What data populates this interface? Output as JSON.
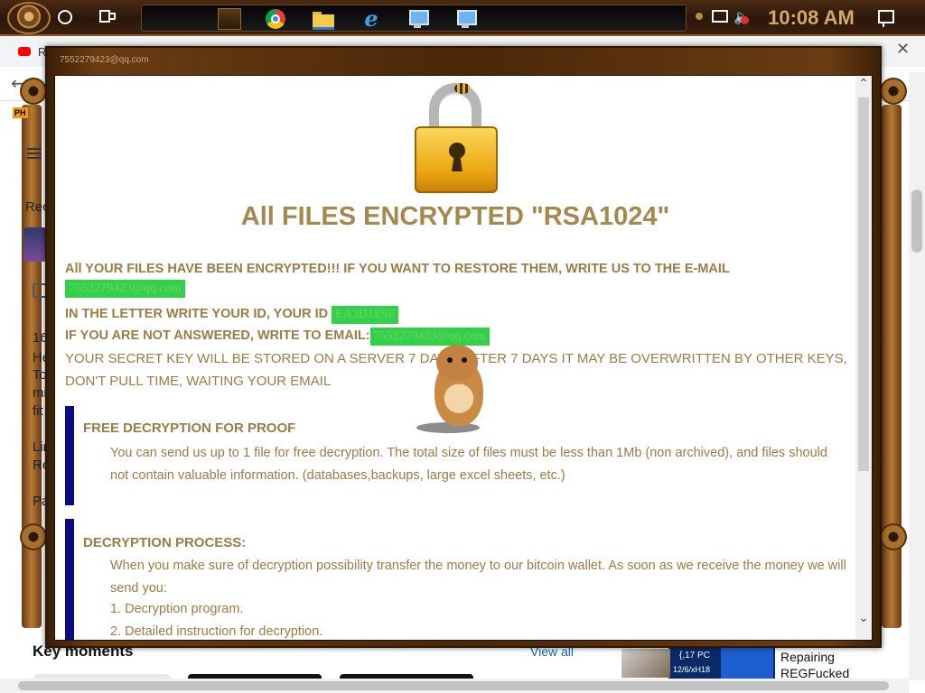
{
  "taskbar": {
    "clock": "10:08 AM",
    "apps": [
      "file-manager",
      "chrome",
      "file-explorer",
      "internet-explorer",
      "computer",
      "computer"
    ]
  },
  "browser": {
    "tab_title": "R",
    "close_x": "✕",
    "back_arrow": "←",
    "ph_badge": "PH",
    "texts": {
      "rec": "Rec",
      "line_16": "16",
      "line_he": "He",
      "line_to": "To",
      "line_mi": "mi",
      "line_fit": "fit",
      "line_lir": "Lir",
      "line_re": "Re",
      "line_pa": "Pa"
    },
    "key_moments": "Key moments",
    "view_all": "View all",
    "side_card": {
      "caption1": "{,17 PC",
      "caption2": "12/6/xH18",
      "title1": "Repairing",
      "title2": "REGFucked"
    }
  },
  "ransom": {
    "window_title": "7552279423@qq.com",
    "heading": "All FILES ENCRYPTED \"RSA1024\"",
    "line1_text": "All YOUR FILES HAVE BEEN ENCRYPTED!!! IF YOU WANT TO RESTORE THEM, WRITE US TO THE E-MAIL",
    "line1_email": "7552279423@qq.com",
    "line2_text": "IN THE LETTER WRITE YOUR ID, YOUR ID",
    "line2_id": "EA3D1E9F",
    "line3_text": "IF YOU ARE NOT ANSWERED, WRITE TO EMAIL:",
    "line3_email": "7552279423@qq.com",
    "line4": "YOUR SECRET KEY WILL BE STORED ON A SERVER 7 DAYS, AFTER 7 DAYS IT MAY BE OVERWRITTEN BY OTHER KEYS,",
    "line5": "DON'T PULL TIME, WAITING YOUR EMAIL",
    "section1": {
      "title": "FREE DECRYPTION FOR PROOF",
      "text": "You can send us up to 1 file for free decryption. The total size of files must be less than 1Mb (non archived), and files should not contain valuable information. (databases,backups, large excel sheets, etc.)"
    },
    "section2": {
      "title": "DECRYPTION PROCESS:",
      "text": "When you make sure of decryption possibility transfer the money to our bitcoin wallet. As soon as we receive the money we will send you:",
      "items": [
        "1. Decryption program.",
        "2. Detailed instruction for decryption."
      ]
    }
  },
  "colors": {
    "text_gold": "#9a7c45",
    "heading_gold": "#a4884e",
    "highlight_green": "#33d14a",
    "section_bar": "#0c0c80",
    "frame_brown": "#4a2709"
  }
}
